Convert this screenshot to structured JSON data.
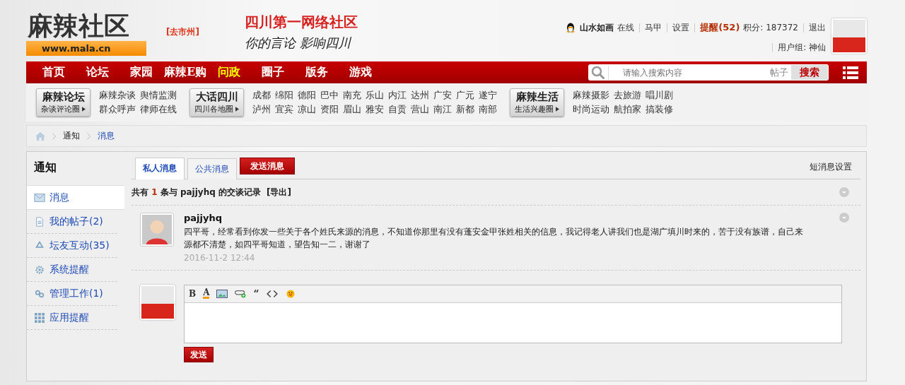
{
  "header": {
    "logo_title": "麻辣社区",
    "logo_url": "www.mala.cn",
    "city_link": "[去市州]",
    "slogan_title": "四川第一网络社区",
    "slogan_sub": "你的言论 影响四川",
    "user": {
      "name": "山水如画",
      "status": "在线",
      "links": [
        "马甲",
        "设置"
      ],
      "reminder": "提醒(52)",
      "points": "积分: 187372",
      "logout": "退出",
      "group": "用户组: 神仙"
    }
  },
  "nav": {
    "items": [
      {
        "label": "首页",
        "selected": false
      },
      {
        "label": "论坛",
        "selected": false
      },
      {
        "label": "家园",
        "selected": false
      },
      {
        "label": "麻辣E购",
        "selected": false
      },
      {
        "label": "问政",
        "selected": true
      },
      {
        "label": "圈子",
        "selected": false
      },
      {
        "label": "版务",
        "selected": false
      },
      {
        "label": "游戏",
        "selected": false
      }
    ],
    "search": {
      "placeholder": "请输入搜索内容",
      "scope": "帖子",
      "button": "搜索"
    }
  },
  "subnav": [
    {
      "title": "麻辣论坛",
      "sub": "杂谈评论圈",
      "links": [
        "麻辣杂谈",
        "舆情监测",
        "群众呼声",
        "律师在线"
      ]
    },
    {
      "title": "大话四川",
      "sub": "四川各地圈",
      "links": [
        "成都",
        "绵阳",
        "德阳",
        "巴中",
        "南充",
        "乐山",
        "内江",
        "达州",
        "广安",
        "广元",
        "遂宁",
        "泸州",
        "宜宾",
        "凉山",
        "资阳",
        "眉山",
        "雅安",
        "自贡",
        "营山",
        "南江",
        "新都",
        "南部"
      ]
    },
    {
      "title": "麻辣生活",
      "sub": "生活兴趣圈",
      "links": [
        "麻辣摄影",
        "去旅游",
        "唱川剧",
        "时尚运动",
        "航拍家",
        "搞装修"
      ]
    }
  ],
  "breadcrumb": [
    "通知",
    "消息"
  ],
  "sidebar": {
    "title": "通知",
    "items": [
      {
        "label": "消息",
        "selected": true
      },
      {
        "label": "我的帖子(2)",
        "selected": false
      },
      {
        "label": "坛友互动(35)",
        "selected": false
      },
      {
        "label": "系统提醒",
        "selected": false
      },
      {
        "label": "管理工作(1)",
        "selected": false
      },
      {
        "label": "应用提醒",
        "selected": false
      }
    ]
  },
  "tabs": [
    {
      "label": "私人消息",
      "selected": true
    },
    {
      "label": "公共消息",
      "selected": false
    }
  ],
  "send_button": "发送消息",
  "settings_link": "短消息设置",
  "summary": {
    "prefix": "共有",
    "count": "1",
    "suffix": "条与 pajjyhq 的交谈记录",
    "export": "[导出]"
  },
  "messages": [
    {
      "author": "pajjyhq",
      "text": "四平哥，经常看到你发一些关于各个姓氏来源的消息，不知道你那里有没有蓬安金甲张姓相关的信息，我记得老人讲我们也是湖广填川时来的，苦于没有族谱，自己来源都不清楚，如四平哥知道，望告知一二，谢谢了",
      "time": "2016-11-2 12:44"
    }
  ],
  "editor": {
    "toolbar": [
      {
        "kind": "bold",
        "glyph": "B"
      },
      {
        "kind": "color",
        "glyph": "A"
      },
      {
        "kind": "image"
      },
      {
        "kind": "link"
      },
      {
        "kind": "quote",
        "glyph": "“"
      },
      {
        "kind": "code"
      },
      {
        "kind": "emoji"
      }
    ],
    "submit": "发送"
  }
}
